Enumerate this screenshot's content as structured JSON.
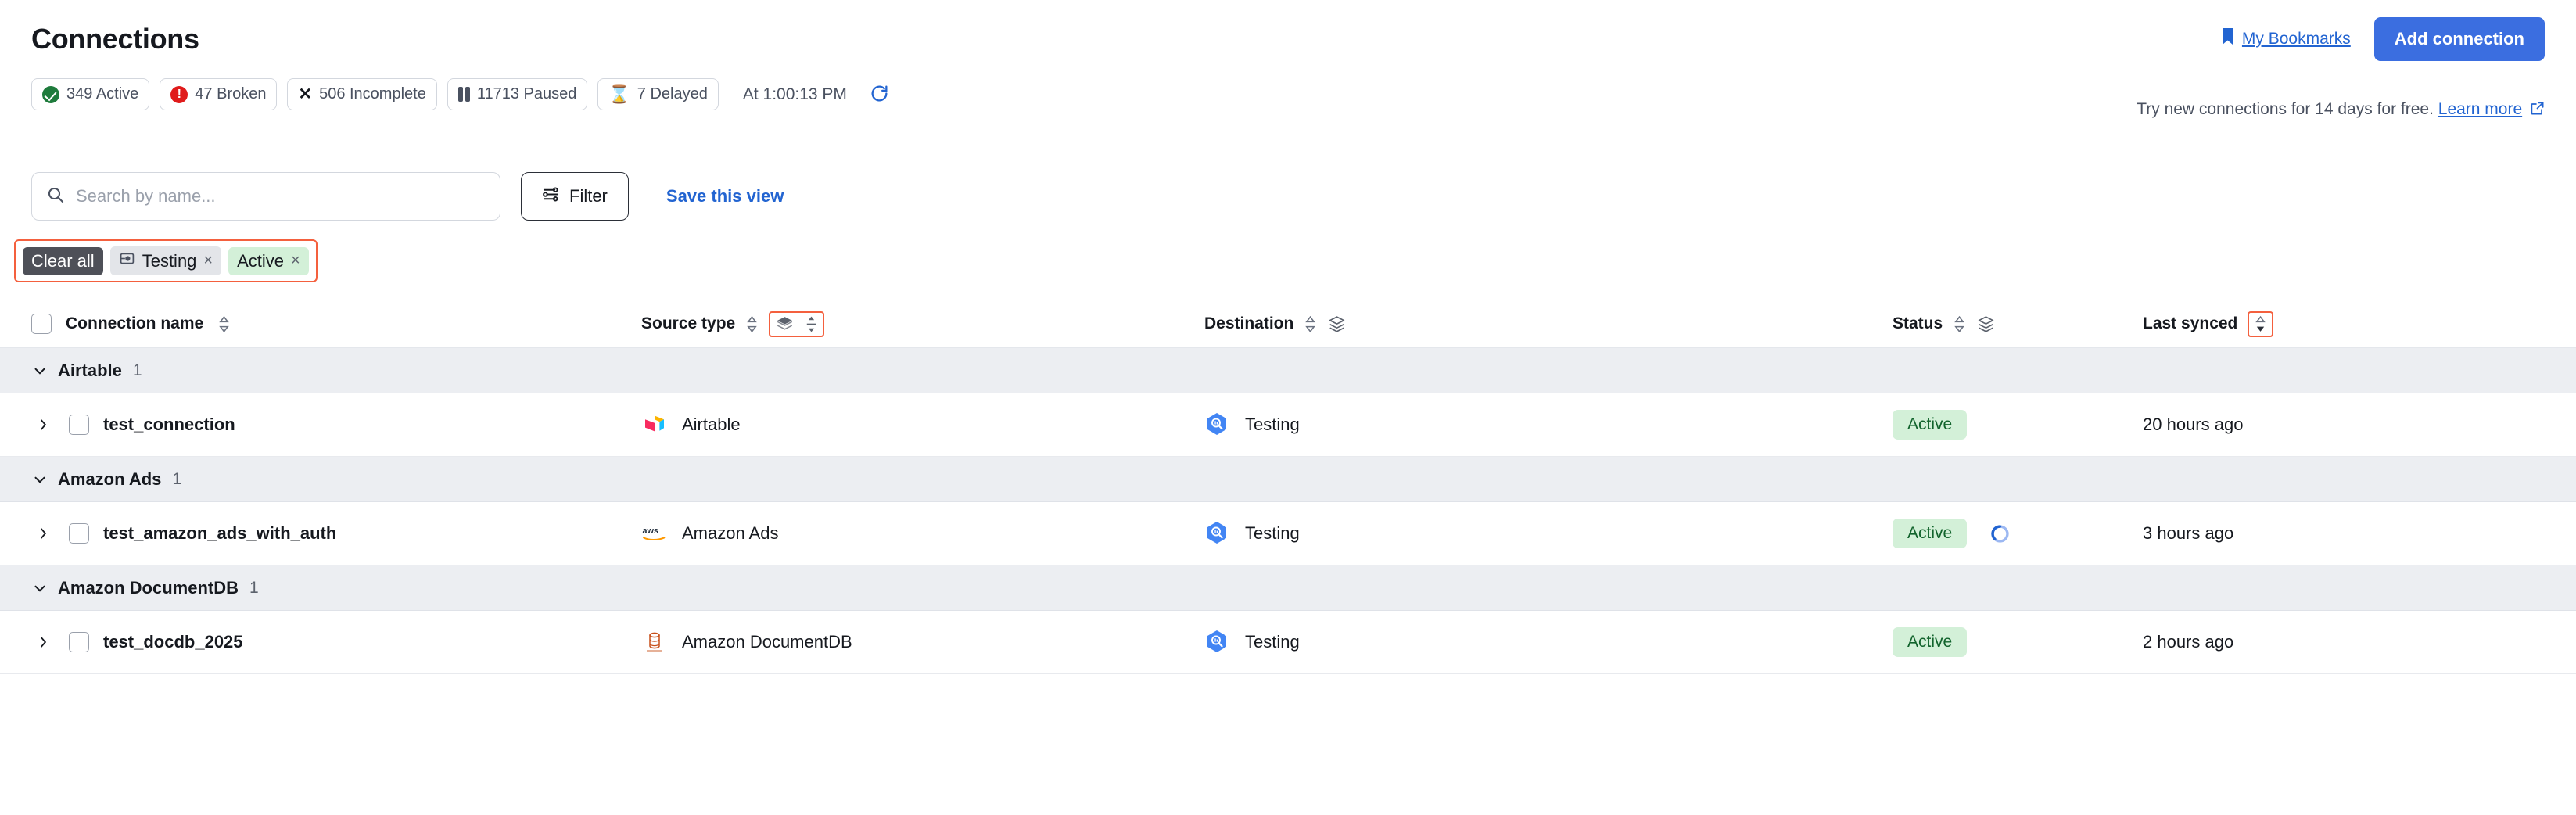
{
  "header": {
    "title": "Connections",
    "bookmarks_label": "My Bookmarks",
    "bookmarks_icon": "bookmark-icon",
    "add_connection_label": "Add connection",
    "sync_time": "At 1:00:13 PM",
    "refresh_icon": "refresh-icon",
    "promo_text": "Try new connections for 14 days for free.",
    "promo_link": "Learn more",
    "promo_link_icon": "external-link-icon",
    "status_chips": [
      {
        "icon": "check-circle-icon",
        "label": "349 Active"
      },
      {
        "icon": "alert-circle-icon",
        "label": "47 Broken"
      },
      {
        "icon": "x-icon",
        "label": "506 Incomplete"
      },
      {
        "icon": "pause-icon",
        "label": "11713 Paused"
      },
      {
        "icon": "hourglass-icon",
        "label": "7 Delayed"
      }
    ]
  },
  "toolbar": {
    "search_placeholder": "Search by name...",
    "search_value": "",
    "search_icon": "search-icon",
    "filter_label": "Filter",
    "filter_icon": "filter-sliders-icon",
    "save_view_label": "Save this view"
  },
  "filters": {
    "clear_all_label": "Clear all",
    "chips": [
      {
        "label": "Testing",
        "icon": "destination-icon",
        "close": "×",
        "variant": "gray"
      },
      {
        "label": "Active",
        "icon": "",
        "close": "×",
        "variant": "green"
      }
    ]
  },
  "table": {
    "columns": [
      {
        "label": "Connection name",
        "sort": "sortable",
        "has_layers": false,
        "highlight": false
      },
      {
        "label": "Source type",
        "sort": "sortable",
        "has_layers": true,
        "highlight": true
      },
      {
        "label": "Destination",
        "sort": "sortable",
        "has_layers": true,
        "highlight": false
      },
      {
        "label": "Status",
        "sort": "sortable",
        "has_layers": true,
        "highlight": false
      },
      {
        "label": "Last synced",
        "sort": "sorted-desc",
        "has_layers": false,
        "highlight": true
      }
    ],
    "groups": [
      {
        "name": "Airtable",
        "count": "1",
        "rows": [
          {
            "name": "test_connection",
            "source_type": "Airtable",
            "source_icon": "airtable-icon",
            "destination": "Testing",
            "destination_icon": "bigquery-icon",
            "status": "Active",
            "loading": false,
            "last_synced": "20 hours ago"
          }
        ]
      },
      {
        "name": "Amazon Ads",
        "count": "1",
        "rows": [
          {
            "name": "test_amazon_ads_with_auth",
            "source_type": "Amazon Ads",
            "source_icon": "aws-icon",
            "destination": "Testing",
            "destination_icon": "bigquery-icon",
            "status": "Active",
            "loading": true,
            "last_synced": "3 hours ago"
          }
        ]
      },
      {
        "name": "Amazon DocumentDB",
        "count": "1",
        "rows": [
          {
            "name": "test_docdb_2025",
            "source_type": "Amazon DocumentDB",
            "source_icon": "documentdb-icon",
            "destination": "Testing",
            "destination_icon": "bigquery-icon",
            "status": "Active",
            "loading": false,
            "last_synced": "2 hours ago"
          }
        ]
      }
    ]
  },
  "colors": {
    "accent_blue": "#3b6ee0",
    "link_blue": "#2264d1",
    "highlight_red": "#f4603e",
    "active_green_bg": "#d3f0d8",
    "active_green_text": "#11632c",
    "broken_red": "#e01b1b",
    "delayed_orange": "#f08c00",
    "group_row_bg": "#eceef2"
  }
}
